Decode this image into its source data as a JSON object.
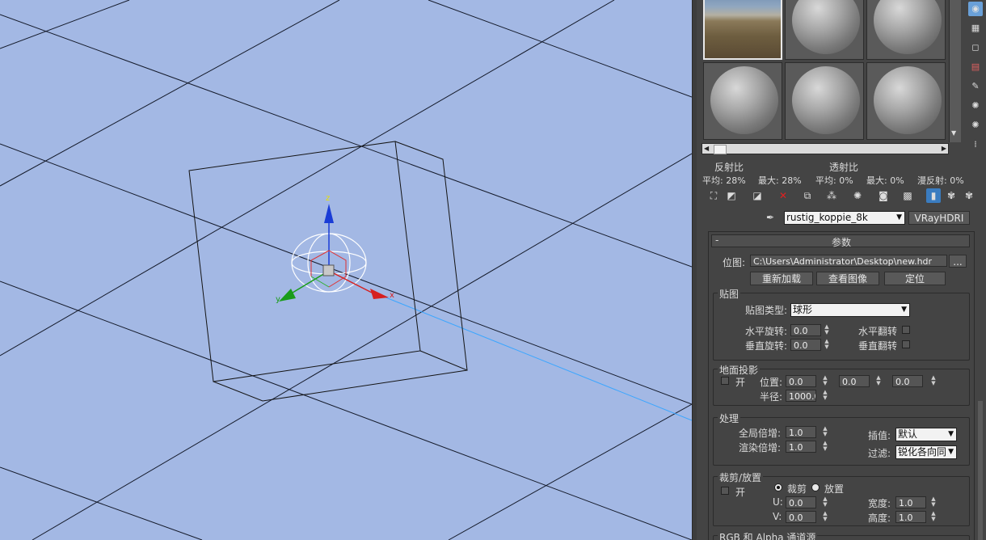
{
  "viewport": {
    "axis_labels": {
      "x": "x",
      "y": "y",
      "z": "z"
    },
    "colors": {
      "background": "#a3b8e4",
      "grid": "#141a2a",
      "x_axis": "#d62020",
      "y_axis": "#1a9c1a",
      "z_axis": "#1a3cd6",
      "ray": "#3aa6ff"
    }
  },
  "material_slots": [
    {
      "type": "hdri",
      "selected": true
    },
    {
      "type": "sphere"
    },
    {
      "type": "sphere"
    },
    {
      "type": "sphere"
    },
    {
      "type": "sphere"
    },
    {
      "type": "sphere"
    }
  ],
  "side_tools": [
    "pick-material-icon",
    "checker-background-icon",
    "backlight-icon",
    "color-check-icon",
    "make-preview-icon",
    "options-icon",
    "select-by-material-icon",
    "material-map-navigator-icon"
  ],
  "stats": {
    "reflect_title": "反射比",
    "transmit_title": "透射比",
    "reflect_avg": "平均:  28%",
    "reflect_max": "最大:   28%",
    "transmit_avg": "平均:    0%",
    "transmit_max": "最大:    0%",
    "diffuse_reflect": "漫反射:    0%"
  },
  "toolbar_icons": [
    "get-material-icon",
    "put-to-scene-icon",
    "assign-to-selection-icon",
    "reset-map-icon",
    "copy-material-icon",
    "make-unique-icon",
    "put-to-library-icon",
    "material-id-channel-icon",
    "show-shaded-icon",
    "show-end-result-icon",
    "go-to-parent-icon",
    "go-forward-sibling-icon"
  ],
  "material": {
    "name": "rustig_koppie_8k",
    "type_button": "VRayHDRI"
  },
  "rollout": {
    "collapse": "-",
    "title": "参数",
    "path_label": "位图:",
    "path_value": "C:\\Users\\Administrator\\Desktop\\new.hdr",
    "browse": "...",
    "reload": "重新加载",
    "view_image": "查看图像",
    "locate": "定位",
    "mapping_group": "贴图",
    "map_type_label": "贴图类型:",
    "map_type_value": "球形",
    "h_rotate_label": "水平旋转:",
    "h_rotate_value": "0.0",
    "v_rotate_label": "垂直旋转:",
    "v_rotate_value": "0.0",
    "h_flip_label": "水平翻转",
    "v_flip_label": "垂直翻转",
    "ground_group": "地面投影",
    "ground_on": "开",
    "ground_pos_label": "位置:",
    "ground_pos_x": "0.0",
    "ground_pos_y": "0.0",
    "ground_pos_z": "0.0",
    "ground_radius_label": "半径:",
    "ground_radius_value": "1000.0",
    "process_group": "处理",
    "global_mult_label": "全局倍增:",
    "global_mult_value": "1.0",
    "render_mult_label": "渲染倍增:",
    "render_mult_value": "1.0",
    "interp_label": "插值:",
    "interp_value": "默认",
    "filter_label": "过滤:",
    "filter_value": "锐化各向同",
    "crop_group": "裁剪/放置",
    "crop_on": "开",
    "crop_label": "裁剪",
    "place_label": "放置",
    "u_label": "U:",
    "u_value": "0.0",
    "v_label": "V:",
    "v_value": "0.0",
    "width_label": "宽度:",
    "width_value": "1.0",
    "height_label": "高度:",
    "height_value": "1.0",
    "next_group": "RGB 和 Alpha 通道源"
  }
}
